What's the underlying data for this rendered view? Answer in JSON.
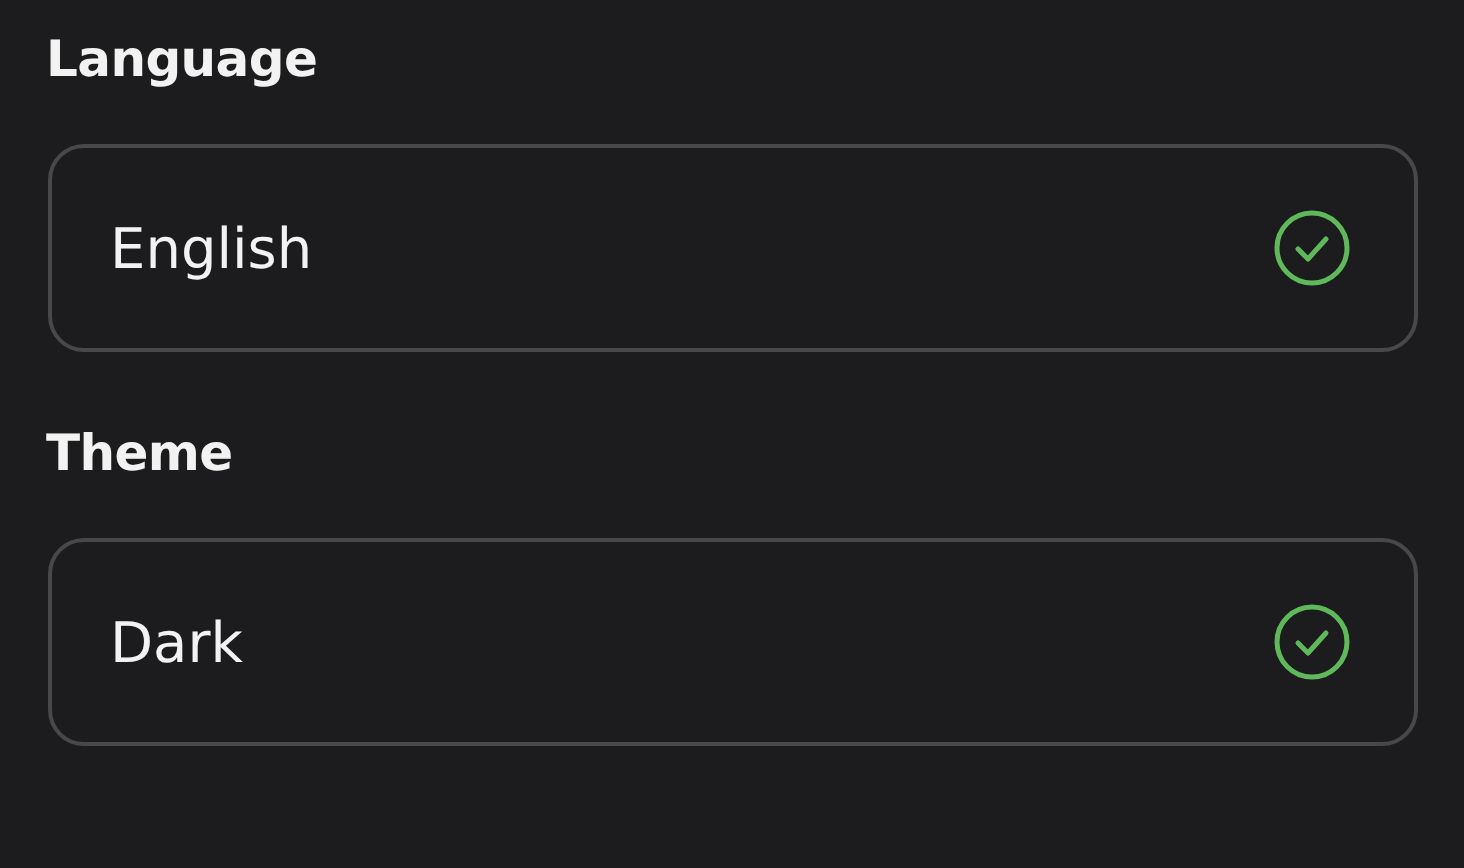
{
  "settings": [
    {
      "label": "Language",
      "value": "English",
      "selected": true
    },
    {
      "label": "Theme",
      "value": "Dark",
      "selected": true
    }
  ]
}
